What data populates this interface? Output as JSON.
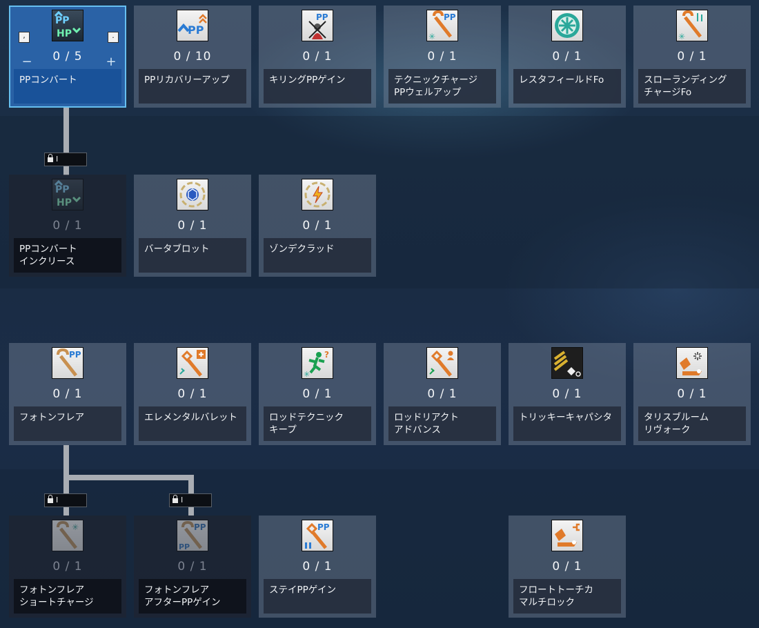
{
  "skills": {
    "pp_convert": {
      "level": "0 / 5",
      "name": "PPコンバート",
      "indicator_left": ",",
      "indicator_right": ".",
      "minus": "−",
      "plus": "+"
    },
    "pp_recovery_up": {
      "level": "0 / 10",
      "name": "PPリカバリーアップ"
    },
    "killing_pp_gain": {
      "level": "0 / 1",
      "name": "キリングPPゲイン"
    },
    "technic_charge_pp_well_up": {
      "level": "0 / 1",
      "name": "テクニックチャージ\nPPウェルアップ"
    },
    "resta_field_fo": {
      "level": "0 / 1",
      "name": "レスタフィールドFo"
    },
    "slow_landing_charge_fo": {
      "level": "0 / 1",
      "name": "スローランディング\nチャージFo"
    },
    "pp_convert_increase": {
      "level": "0 / 1",
      "name": "PPコンバート\nインクリース"
    },
    "barta_blot": {
      "level": "0 / 1",
      "name": "バータブロット"
    },
    "zonde_clad": {
      "level": "0 / 1",
      "name": "ゾンデクラッド"
    },
    "photon_flare": {
      "level": "0 / 1",
      "name": "フォトンフレア"
    },
    "elemental_bullet": {
      "level": "0 / 1",
      "name": "エレメンタルバレット"
    },
    "rod_technic_keep": {
      "level": "0 / 1",
      "name": "ロッドテクニック\nキープ"
    },
    "rod_react_advance": {
      "level": "0 / 1",
      "name": "ロッドリアクト\nアドバンス"
    },
    "tricky_capacitor": {
      "level": "0 / 1",
      "name": "トリッキーキャパシタ"
    },
    "talis_bloom_revoke": {
      "level": "0 / 1",
      "name": "タリスブルーム\nリヴォーク"
    },
    "photon_flare_short_charge": {
      "level": "0 / 1",
      "name": "フォトンフレア\nショートチャージ"
    },
    "photon_flare_after_pp_gain": {
      "level": "0 / 1",
      "name": "フォトンフレア\nアフターPPゲイン"
    },
    "stay_pp_gain": {
      "level": "0 / 1",
      "name": "ステイPPゲイン"
    },
    "float_torch_multi_lock": {
      "level": "0 / 1",
      "name": "フロートトーチカ\nマルチロック"
    }
  },
  "locks": {
    "pp_convert_increase": "I",
    "photon_flare_short_charge": "I",
    "photon_flare_after_pp_gain": "I"
  },
  "icons": {
    "pp_convert": "pp-hp-convert-icon",
    "pp_recovery_up": "pp-recovery-up-icon",
    "killing_pp_gain": "killing-pp-gain-icon",
    "technic_charge_pp_well_up": "technic-charge-pp-icon",
    "resta_field_fo": "resta-field-icon",
    "slow_landing_charge_fo": "slow-landing-charge-icon",
    "pp_convert_increase": "pp-hp-convert-icon",
    "barta_blot": "barta-blot-icon",
    "zonde_clad": "zonde-clad-icon",
    "photon_flare": "photon-flare-icon",
    "elemental_bullet": "elemental-bullet-icon",
    "rod_technic_keep": "rod-technic-keep-icon",
    "rod_react_advance": "rod-react-advance-icon",
    "tricky_capacitor": "tricky-capacitor-icon",
    "talis_bloom_revoke": "talis-bloom-revoke-icon",
    "photon_flare_short_charge": "photon-flare-short-charge-icon",
    "photon_flare_after_pp_gain": "photon-flare-after-pp-icon",
    "stay_pp_gain": "stay-pp-gain-icon",
    "float_torch_multi_lock": "float-torch-icon"
  },
  "colors": {
    "selected_bg": "#2a62a6",
    "selected_border": "#66bff0",
    "orange_accent": "#e07a2a",
    "teal_accent": "#2aa89a"
  }
}
